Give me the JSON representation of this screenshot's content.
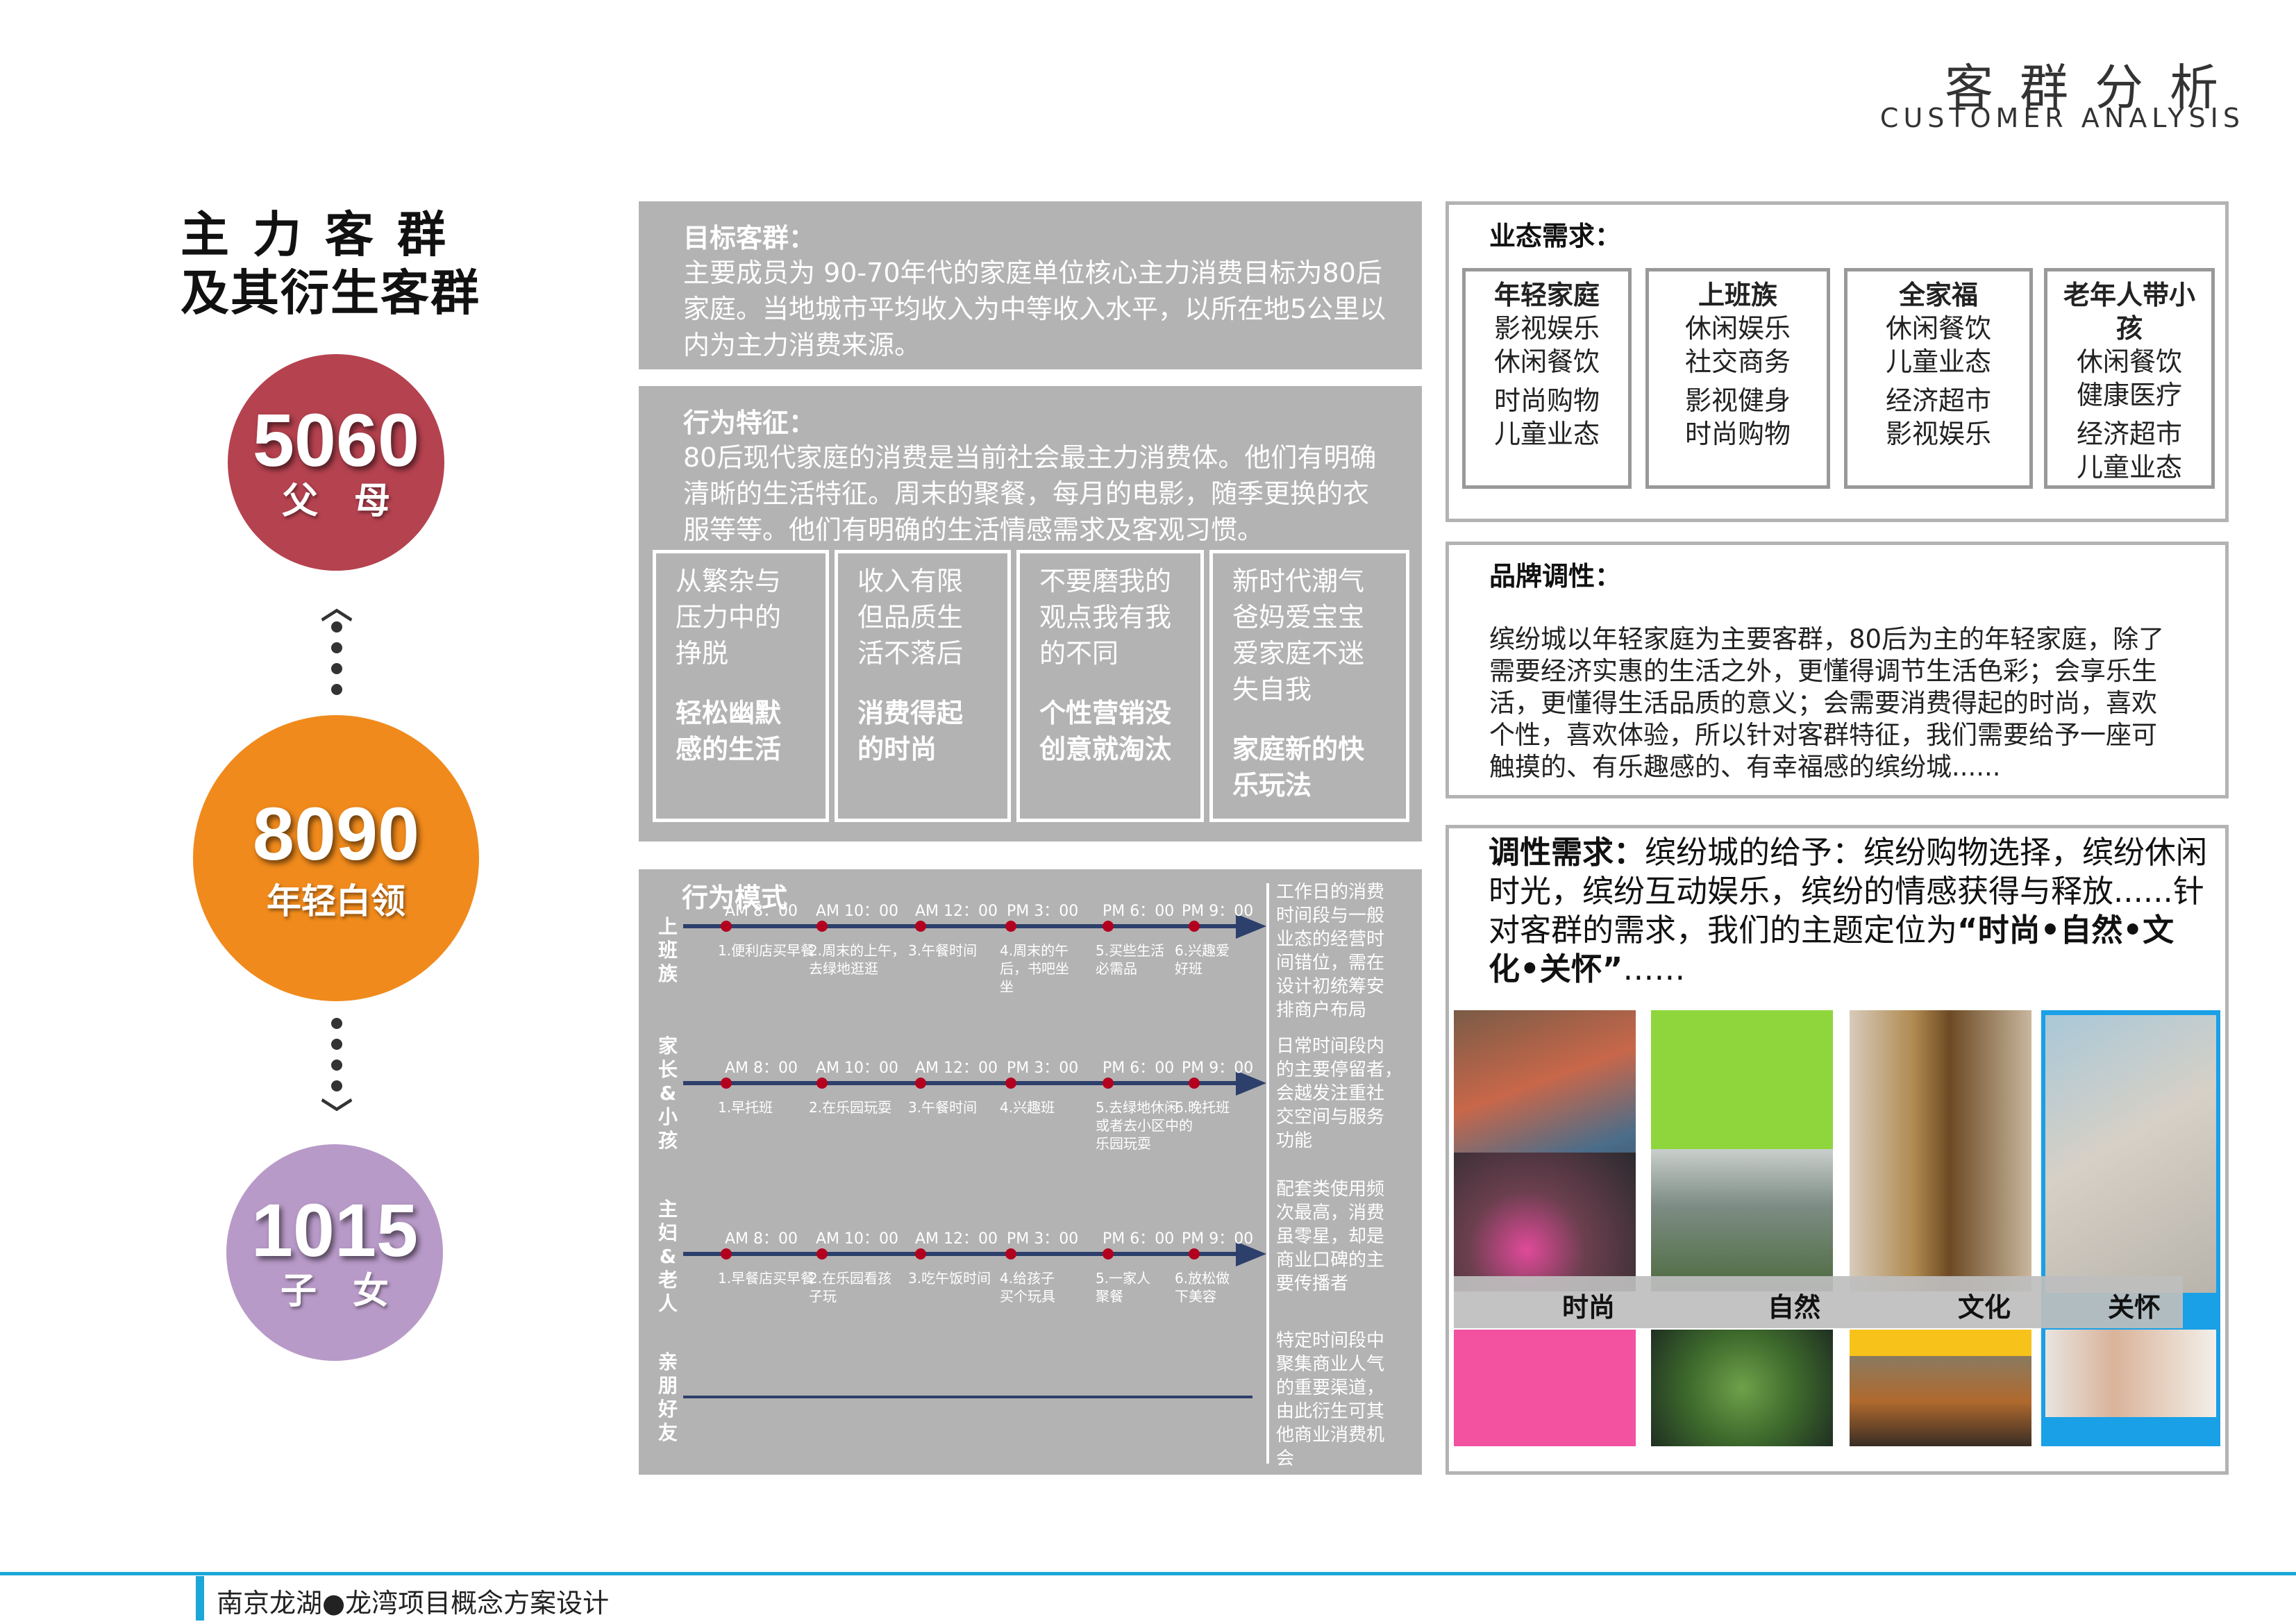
{
  "header": {
    "title_zh": "客群分析",
    "title_en": "CUSTOMER ANALYSIS"
  },
  "left": {
    "title_line1": "主力客群",
    "title_line2": "及其衍生客群",
    "circles": [
      {
        "number": "5060",
        "label": "父　母",
        "color": "#b5424f"
      },
      {
        "number": "8090",
        "label": "年轻白领",
        "color": "#f08a1c"
      },
      {
        "number": "1015",
        "label": "子　女",
        "color": "#b89ac8"
      }
    ]
  },
  "target": {
    "title": "目标客群：",
    "text": "主要成员为 90-70年代的家庭单位核心主力消费目标为80后\n家庭。当地城市平均收入为中等收入水平，以所在地5公里以\n内为主力消费来源。"
  },
  "behavior": {
    "title": "行为特征：",
    "text": "80后现代家庭的消费是当前社会最主力消费体。他们有明确\n清晰的生活特征。周末的聚餐，每月的电影，随季更换的衣\n服等等。他们有明确的生活情感需求及客观习惯。",
    "cards": [
      {
        "text": "从繁杂与\n压力中的\n挣脱",
        "bold": "轻松幽默\n感的生活"
      },
      {
        "text": "收入有限\n但品质生\n活不落后",
        "bold": "消费得起\n的时尚"
      },
      {
        "text": "不要磨我的\n观点我有我\n的不同",
        "bold": "个性营销没\n创意就淘汰"
      },
      {
        "text": "新时代潮气\n爸妈爱宝宝\n爱家庭不迷\n失自我",
        "bold": "家庭新的快\n乐玩法"
      }
    ]
  },
  "pattern": {
    "title": "行为模式",
    "times": [
      "AM 8：00",
      "AM 10：00",
      "AM 12：00",
      "PM 3：00",
      "PM 6：00",
      "PM 9：00"
    ],
    "rows": [
      {
        "label": "上\n班\n族",
        "acts": [
          "1.便利店买早餐",
          "2.周末的上午，\n去绿地逛逛",
          "3.午餐时间",
          "4.周末的午\n后，书吧坐\n坐",
          "5.买些生活\n必需品",
          "6.兴趣爱\n好班"
        ]
      },
      {
        "label": "家\n长\n&\n小\n孩",
        "acts": [
          "1.早托班",
          "2.在乐园玩耍",
          "3.午餐时间",
          "4.兴趣班",
          "5.去绿地休闲\n或者去小区中的\n乐园玩耍",
          "6.晚托班"
        ]
      },
      {
        "label": "主\n妇\n&\n老\n人",
        "acts": [
          "1.早餐店买早餐",
          "2.在乐园看孩\n子玩",
          "3.吃午饭时间",
          "4.给孩子\n买个玩具",
          "5.一家人\n聚餐",
          "6.放松做\n下美容"
        ]
      },
      {
        "label": "亲\n朋\n好\n友",
        "acts": []
      }
    ],
    "notes": [
      "工作日的消费\n时间段与一般\n业态的经营时\n间错位，需在\n设计初统筹安\n排商户布局",
      "日常时间段内\n的主要停留者，\n会越发注重社\n交空间与服务\n功能",
      "配套类使用频\n次最高，消费\n虽零星，却是\n商业口碑的主\n要传播者",
      "特定时间段中\n聚集商业人气\n的重要渠道，\n由此衍生可其\n他商业消费机\n会"
    ]
  },
  "format_demand": {
    "title": "业态需求：",
    "cards": [
      {
        "head": "年轻家庭",
        "lines": [
          "影视娱乐",
          "休闲餐饮",
          "时尚购物",
          "儿童业态"
        ]
      },
      {
        "head": "上班族",
        "lines": [
          "休闲娱乐",
          "社交商务",
          "影视健身",
          "时尚购物"
        ]
      },
      {
        "head": "全家福",
        "lines": [
          "休闲餐饮",
          "儿童业态",
          "经济超市",
          "影视娱乐"
        ]
      },
      {
        "head": "老年人带小\n孩",
        "lines": [
          "休闲餐饮",
          "健康医疗",
          "经济超市",
          "儿童业态"
        ]
      }
    ]
  },
  "brand": {
    "title": "品牌调性：",
    "text": "缤纷城以年轻家庭为主要客群，80后为主的年轻家庭，除了\n需要经济实惠的生活之外，更懂得调节生活色彩；会享乐生\n活，更懂得生活品质的意义；会需要消费得起的时尚，喜欢\n个性，喜欢体验，所以针对客群特征，我们需要给予一座可\n触摸的、有乐趣感的、有幸福感的缤纷城......"
  },
  "tone": {
    "title": "调性需求：",
    "text1": "缤纷城的给予：缤纷购物选择，缤纷休闲",
    "text2": "时光，缤纷互动娱乐，缤纷的情感获得与释放......针",
    "text3": "对客群的需求，我们的主题定位为",
    "quote": "“时尚•自然•文",
    "quote2": "化•关怀”",
    "ellipsis": "……",
    "labels": [
      "时尚",
      "自然",
      "文化",
      "关怀"
    ],
    "colors": [
      "#f2529f",
      "#8fd63c",
      "#f7c21a",
      "#1aa0e6"
    ]
  },
  "footer": {
    "text": "南京龙湖●龙湾项目概念方案设计",
    "accent": "#1da6d8"
  }
}
